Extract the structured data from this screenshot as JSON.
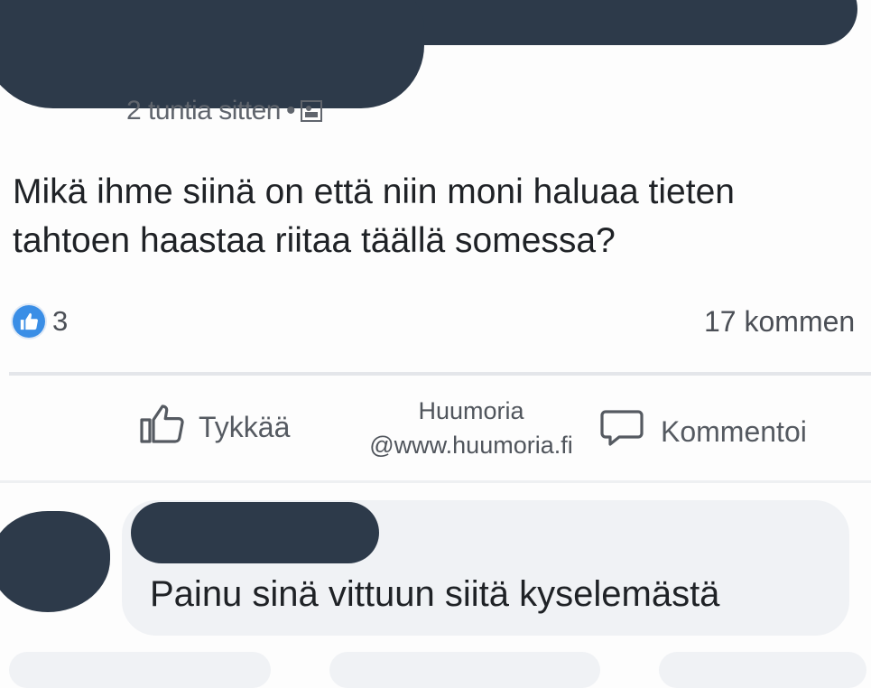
{
  "post": {
    "timestamp": "2 tuntia sitten",
    "separator": "•",
    "privacy_icon": "friends-group-icon",
    "text": "Mikä ihme siinä on että niin moni haluaa tieten tahtoen haastaa riitaa täällä somessa?"
  },
  "stats": {
    "reaction_icon": "like-icon",
    "reaction_count": "3",
    "comment_count_text": "17 kommen"
  },
  "actions": {
    "like_label": "Tykkää",
    "comment_label": "Kommentoi"
  },
  "watermark": {
    "line1": "Huumoria",
    "line2": "@www.huumoria.fi"
  },
  "comment": {
    "text": "Painu sinä vittuun siitä kyselemästä"
  },
  "colors": {
    "redaction": "#2d3a4a",
    "like_blue": "#3a8ee6",
    "bubble_bg": "#f0f2f5"
  }
}
